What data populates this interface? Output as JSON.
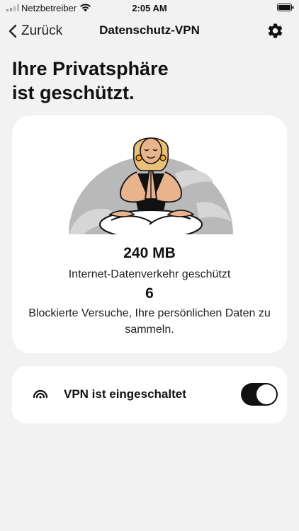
{
  "status_bar": {
    "carrier": "Netzbetreiber",
    "time": "2:05 AM",
    "signal_icon": "cellular-signal-icon",
    "wifi_icon": "wifi-icon",
    "battery_icon": "battery-icon"
  },
  "nav": {
    "back_label": "Zurück",
    "back_icon": "chevron-left-icon",
    "title": "Datenschutz-VPN",
    "settings_icon": "gear-icon"
  },
  "headline": {
    "line1": "Ihre Privatsphäre",
    "line2": "ist geschützt."
  },
  "stats": {
    "illustration": "meditating-person-illustration",
    "data_protected_value": "240 MB",
    "data_protected_label": "Internet-Datenverkehr geschützt",
    "blocked_value": "6",
    "blocked_label": "Blockierte Versuche, Ihre persönlichen Daten zu sammeln."
  },
  "vpn": {
    "icon": "vpn-signal-icon",
    "label": "VPN ist eingeschaltet",
    "enabled": true
  },
  "colors": {
    "background": "#f2f2f2",
    "card": "#ffffff",
    "toggle_on": "#111111",
    "illustration_accent": "#f5a623",
    "illustration_skin": "#e8b48e"
  }
}
